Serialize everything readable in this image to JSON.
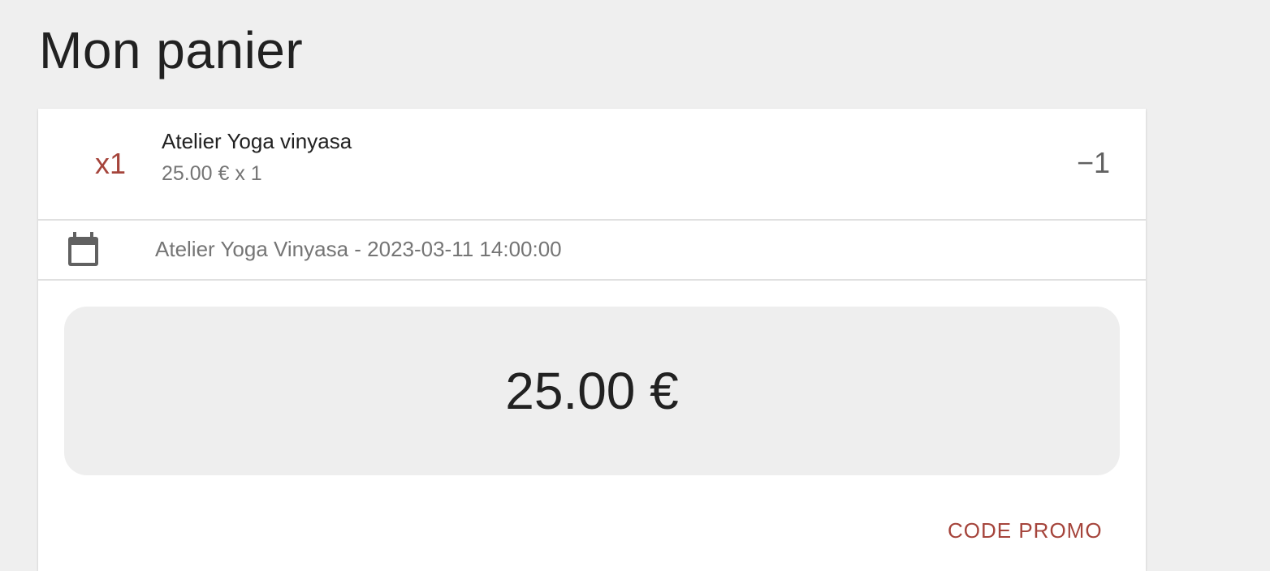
{
  "page": {
    "title": "Mon panier"
  },
  "cart": {
    "items": [
      {
        "quantity_label": "x1",
        "name": "Atelier Yoga vinyasa",
        "price_line": "25.00 € x 1",
        "decrement_label": "−1"
      }
    ],
    "event": {
      "icon": "calendar-icon",
      "text": "Atelier Yoga Vinyasa - 2023-03-11 14:00:00"
    },
    "total": "25.00 €",
    "promo_label": "CODE PROMO"
  },
  "colors": {
    "background": "#efefef",
    "accent": "#a5443b",
    "card": "#ffffff",
    "total_box": "#eeeeee",
    "muted_text": "#757575"
  }
}
